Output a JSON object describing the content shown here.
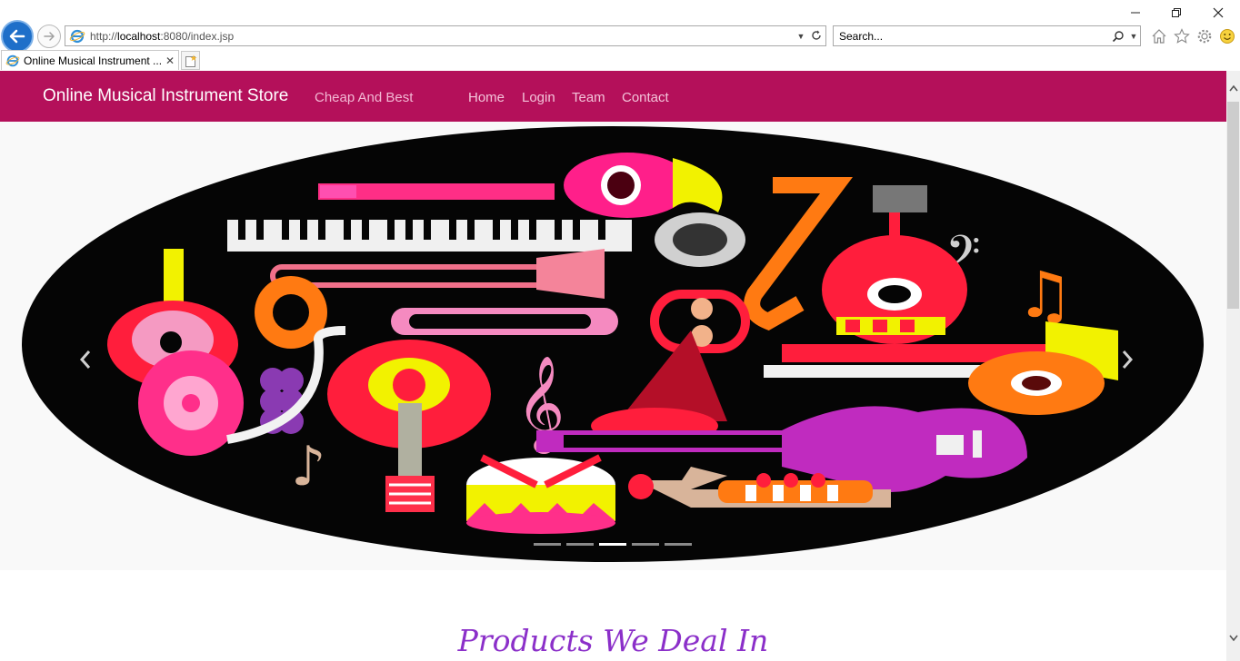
{
  "browser": {
    "address": {
      "scheme": "http://",
      "host": "localhost",
      "rest": ":8080/index.jsp"
    },
    "search": {
      "placeholder": "Search..."
    },
    "tab": {
      "title": "Online Musical Instrument ...",
      "close": "✕"
    }
  },
  "navbar": {
    "brand": "Online Musical Instrument Store",
    "tagline": "Cheap And Best",
    "links": [
      "Home",
      "Login",
      "Team",
      "Contact"
    ],
    "color": "#b4105a"
  },
  "carousel": {
    "prev_glyph": "‹",
    "next_glyph": "›",
    "indicator_count": 5,
    "active_indicator": 3
  },
  "section": {
    "title": "Products We Deal In",
    "color": "#8b2fc9"
  }
}
